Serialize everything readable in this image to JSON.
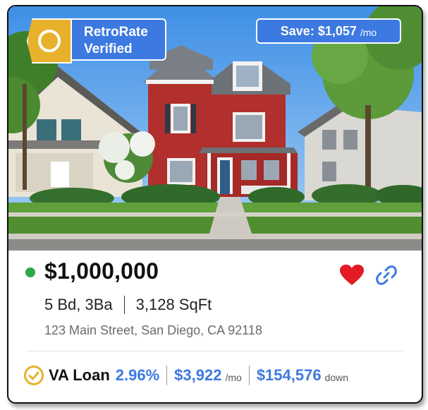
{
  "badge": {
    "label": "RetroRate Verified",
    "icon": "check-circle-icon",
    "color": "#3c79e0",
    "icon_color": "#e7b12c"
  },
  "savings": {
    "label": "Save: $1,057",
    "unit": "/mo"
  },
  "listing": {
    "status_color": "#2da84a",
    "price": "$1,000,000",
    "beds_baths": "5 Bd, 3Ba",
    "sqft": "3,128 SqFt",
    "address": "123 Main Street, San Diego, CA 92118"
  },
  "actions": {
    "favorite_icon": "heart-icon",
    "favorite_color": "#e31b23",
    "share_icon": "link-icon"
  },
  "loan": {
    "icon": "check-circle-icon",
    "type": "VA Loan",
    "rate": "2.96%",
    "payment": "$3,922",
    "payment_unit": "/mo",
    "down": "$154,576",
    "down_unit": "down"
  }
}
